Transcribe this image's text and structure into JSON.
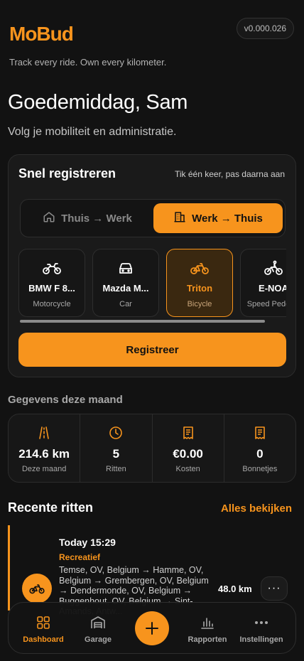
{
  "app": {
    "name": "MoBud",
    "version": "v0.000.026",
    "tagline": "Track every ride. Own every kilometer."
  },
  "header": {
    "greeting": "Goedemiddag, Sam",
    "subtitle": "Volg je mobiliteit en administratie."
  },
  "quick_register": {
    "title": "Snel registreren",
    "hint": "Tik één keer, pas daarna aan",
    "directions": [
      {
        "label": "Thuis → Werk",
        "selected": false,
        "icon": "home-icon"
      },
      {
        "label": "Werk → Thuis",
        "selected": true,
        "icon": "building-icon"
      }
    ],
    "vehicles": [
      {
        "name": "BMW F 8...",
        "type": "Motorcycle",
        "icon": "motorcycle-icon",
        "selected": false
      },
      {
        "name": "Mazda M...",
        "type": "Car",
        "icon": "car-icon",
        "selected": false
      },
      {
        "name": "Triton",
        "type": "Bicycle",
        "icon": "bicycle-icon",
        "selected": true
      },
      {
        "name": "E-NOA",
        "type": "Speed Pedelec",
        "icon": "ebike-icon",
        "selected": false
      }
    ],
    "register_label": "Registreer"
  },
  "month_stats": {
    "title": "Gegevens deze maand",
    "items": [
      {
        "value": "214.6 km",
        "label": "Deze maand",
        "icon": "road-icon"
      },
      {
        "value": "5",
        "label": "Ritten",
        "icon": "clock-icon"
      },
      {
        "value": "€0.00",
        "label": "Kosten",
        "icon": "receipt-icon"
      },
      {
        "value": "0",
        "label": "Bonnetjes",
        "icon": "receipt-icon"
      }
    ]
  },
  "recent": {
    "title": "Recente ritten",
    "see_all": "Alles bekijken",
    "rides": [
      {
        "date": "Today 15:29",
        "category": "Recreatief",
        "route": "Temse, OV, Belgium → Hamme, OV, Belgium → Grembergen, OV, Belgium → Dendermonde, OV, Belgium → Buggenhout, OV, Belgium → Sint-Amands, Antw...",
        "distance": "48.0 km",
        "more": "···"
      }
    ]
  },
  "nav": {
    "items": [
      {
        "label": "Dashboard",
        "icon": "grid-icon",
        "active": true
      },
      {
        "label": "Garage",
        "icon": "garage-icon",
        "active": false
      },
      {
        "label": "Rapporten",
        "icon": "chart-icon",
        "active": false
      },
      {
        "label": "Instellingen",
        "icon": "more-icon",
        "active": false
      }
    ],
    "add_label": "+"
  },
  "colors": {
    "accent": "#F7941D",
    "background": "#121212",
    "card": "#1A1A1A"
  }
}
